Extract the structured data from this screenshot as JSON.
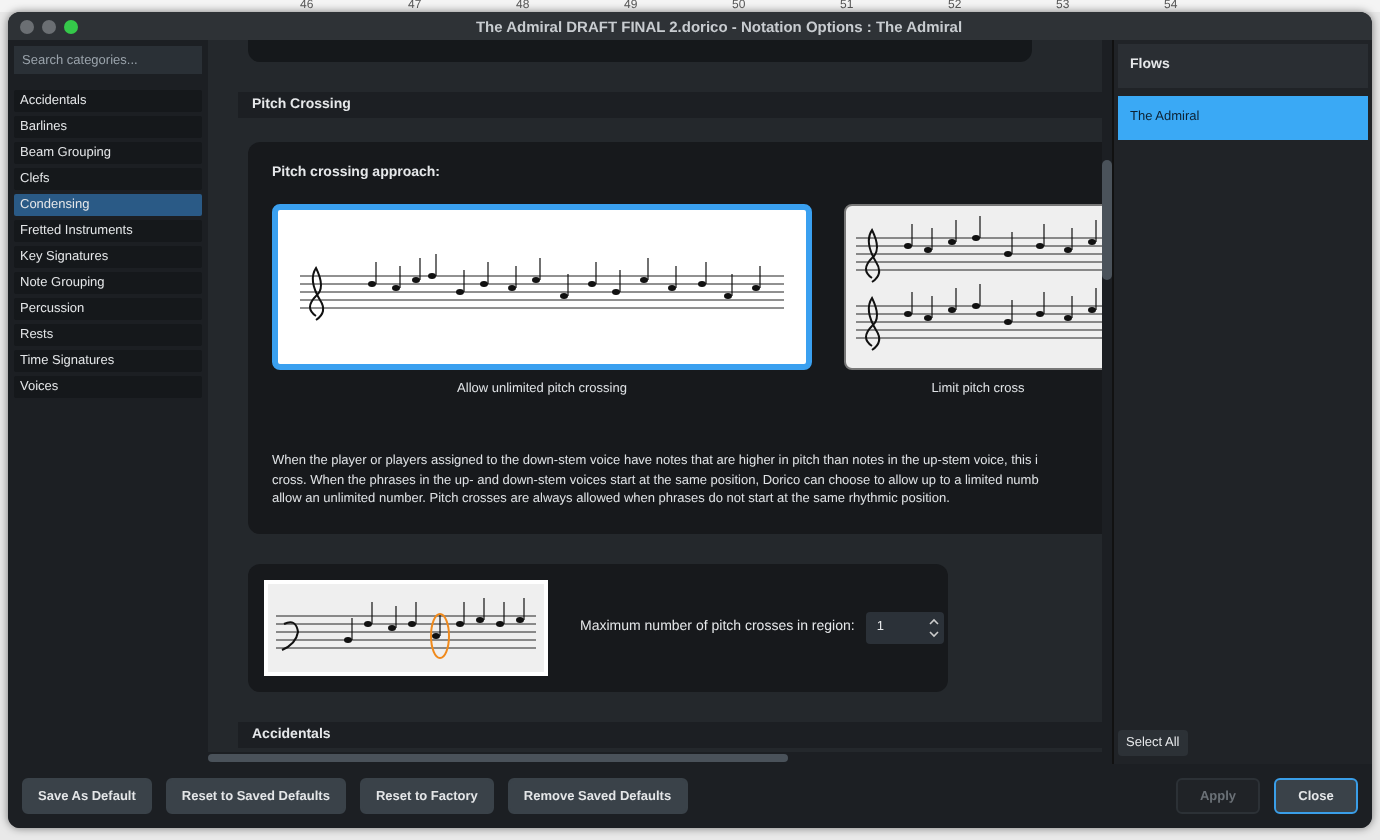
{
  "background": {
    "bar_numbers": [
      "46",
      "47",
      "48",
      "49",
      "50",
      "51",
      "52",
      "53",
      "54"
    ]
  },
  "window": {
    "title": "The Admiral DRAFT FINAL 2.dorico - Notation Options : The Admiral"
  },
  "sidebar": {
    "search": {
      "placeholder": "Search categories..."
    },
    "items": [
      {
        "label": "Accidentals",
        "selected": false
      },
      {
        "label": "Barlines",
        "selected": false
      },
      {
        "label": "Beam Grouping",
        "selected": false
      },
      {
        "label": "Clefs",
        "selected": false
      },
      {
        "label": "Condensing",
        "selected": true
      },
      {
        "label": "Fretted Instruments",
        "selected": false
      },
      {
        "label": "Key Signatures",
        "selected": false
      },
      {
        "label": "Note Grouping",
        "selected": false
      },
      {
        "label": "Percussion",
        "selected": false
      },
      {
        "label": "Rests",
        "selected": false
      },
      {
        "label": "Time Signatures",
        "selected": false
      },
      {
        "label": "Voices",
        "selected": false
      }
    ]
  },
  "pitch_crossing": {
    "header": "Pitch Crossing",
    "approach_label": "Pitch crossing approach:",
    "options": [
      {
        "caption": "Allow unlimited pitch crossing",
        "selected": true
      },
      {
        "caption": "Limit pitch cross",
        "selected": false
      }
    ],
    "description": [
      "When the player or players assigned to the down-stem voice have notes that are higher in pitch than notes in the up-stem voice, this i",
      "cross. When the phrases in the up- and down-stem voices start at the same position, Dorico can choose to allow up to a limited numb",
      "allow an unlimited number. Pitch crosses are always allowed when phrases do not start at the same rhythmic position."
    ],
    "max_crosses": {
      "label": "Maximum number of pitch crosses in region:",
      "value": "1"
    }
  },
  "next_section": {
    "header": "Accidentals"
  },
  "flows": {
    "title": "Flows",
    "items": [
      {
        "label": "The Admiral",
        "selected": true
      }
    ],
    "select_all": "Select All"
  },
  "footer": {
    "left_buttons": [
      {
        "label": "Save As Default"
      },
      {
        "label": "Reset to Saved Defaults"
      },
      {
        "label": "Reset to Factory"
      },
      {
        "label": "Remove Saved Defaults"
      }
    ],
    "right_buttons": [
      {
        "label": "Apply",
        "disabled": true,
        "default": false
      },
      {
        "label": "Close",
        "disabled": false,
        "default": true
      }
    ]
  }
}
